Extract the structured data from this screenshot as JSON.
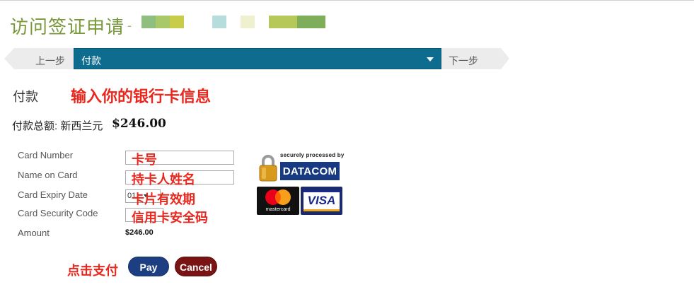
{
  "header": {
    "title": "访问签证申请",
    "dash": "-"
  },
  "steps": {
    "prev_label": "上一步",
    "current_label": "付款",
    "next_label": "下一步"
  },
  "payment": {
    "section_title": "付款",
    "annotation_header": "输入你的银行卡信息",
    "total_label": "付款总额: 新西兰元",
    "total_amount": "$246.00"
  },
  "form": {
    "card_number_label": "Card Number",
    "name_on_card_label": "Name on Card",
    "expiry_label": "Card Expiry Date",
    "security_code_label": "Card Security Code",
    "amount_label": "Amount",
    "amount_value": "$246.00",
    "expiry_month_value": "01"
  },
  "annotations": {
    "card_number": "卡号",
    "name_on_card": "持卡人姓名",
    "expiry": "卡片有效期",
    "security_code": "信用卡安全码",
    "pay_hint": "点击支付"
  },
  "badges": {
    "datacom_caption": "securely processed by",
    "datacom_text": "DATACOM",
    "mastercard_text": "mastercard",
    "visa_text": "VISA"
  },
  "buttons": {
    "pay_label": "Pay",
    "cancel_label": "Cancel"
  },
  "colors": {
    "title_green": "#7a9a3a",
    "step_blue": "#0e6c8f",
    "annotation_red": "#e8281e",
    "pay_blue": "#1e3e82",
    "cancel_red": "#7a1414"
  }
}
